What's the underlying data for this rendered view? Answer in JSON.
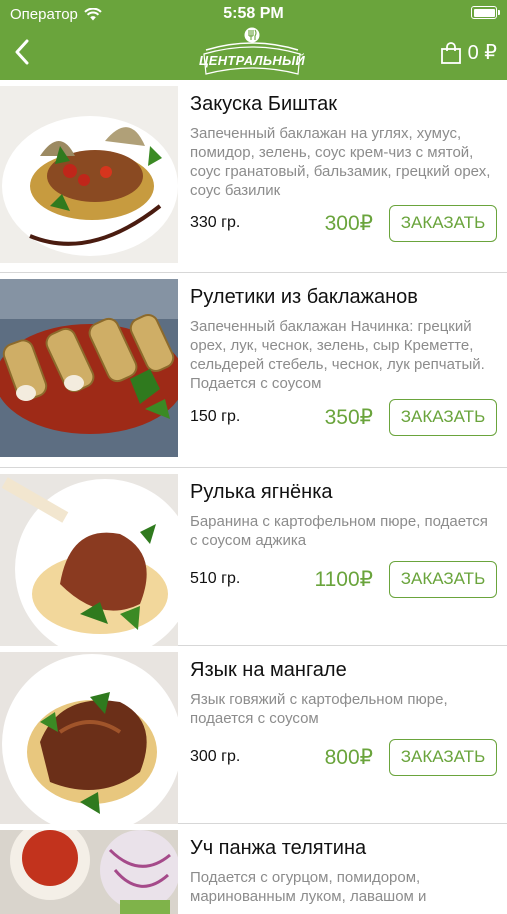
{
  "status_bar": {
    "carrier": "Оператор",
    "time": "5:58 PM"
  },
  "header": {
    "logo_text": "ЦЕНТРАЛЬНЫЙ",
    "cart_count": "0 ₽",
    "brand_color": "#6aa43c"
  },
  "items": [
    {
      "name": "Закуска Биштак",
      "description": "Запеченный баклажан на углях, хумус, помидор, зелень, соус крем-чиз с мятой, соус  гранатовый, бальзамик, грецкий орех, соус базилик",
      "weight": "330 гр.",
      "price": "300₽",
      "order_label": "ЗАКАЗАТЬ"
    },
    {
      "name": "Рулетики из баклажанов",
      "description": "Запеченный баклажан Начинка: грецкий орех, лук, чеснок, зелень, сыр Креметте, сельдерей стебель, чеснок, лук репчатый. Подается с соусом",
      "weight": "150 гр.",
      "price": "350₽",
      "order_label": "ЗАКАЗАТЬ"
    },
    {
      "name": "Рулька ягнёнка",
      "description": "Баранина с картофельном пюре, подается с соусом аджика",
      "weight": "510 гр.",
      "price": "1100₽",
      "order_label": "ЗАКАЗАТЬ"
    },
    {
      "name": "Язык на мангале",
      "description": "Язык говяжий с картофельном пюре, подается с соусом",
      "weight": "300 гр.",
      "price": "800₽",
      "order_label": "ЗАКАЗАТЬ"
    },
    {
      "name": "Уч панжа телятина",
      "description": "Подается с огурцом, помидором, маринованным луком, лавашом и",
      "weight": "",
      "price": "",
      "order_label": ""
    }
  ]
}
